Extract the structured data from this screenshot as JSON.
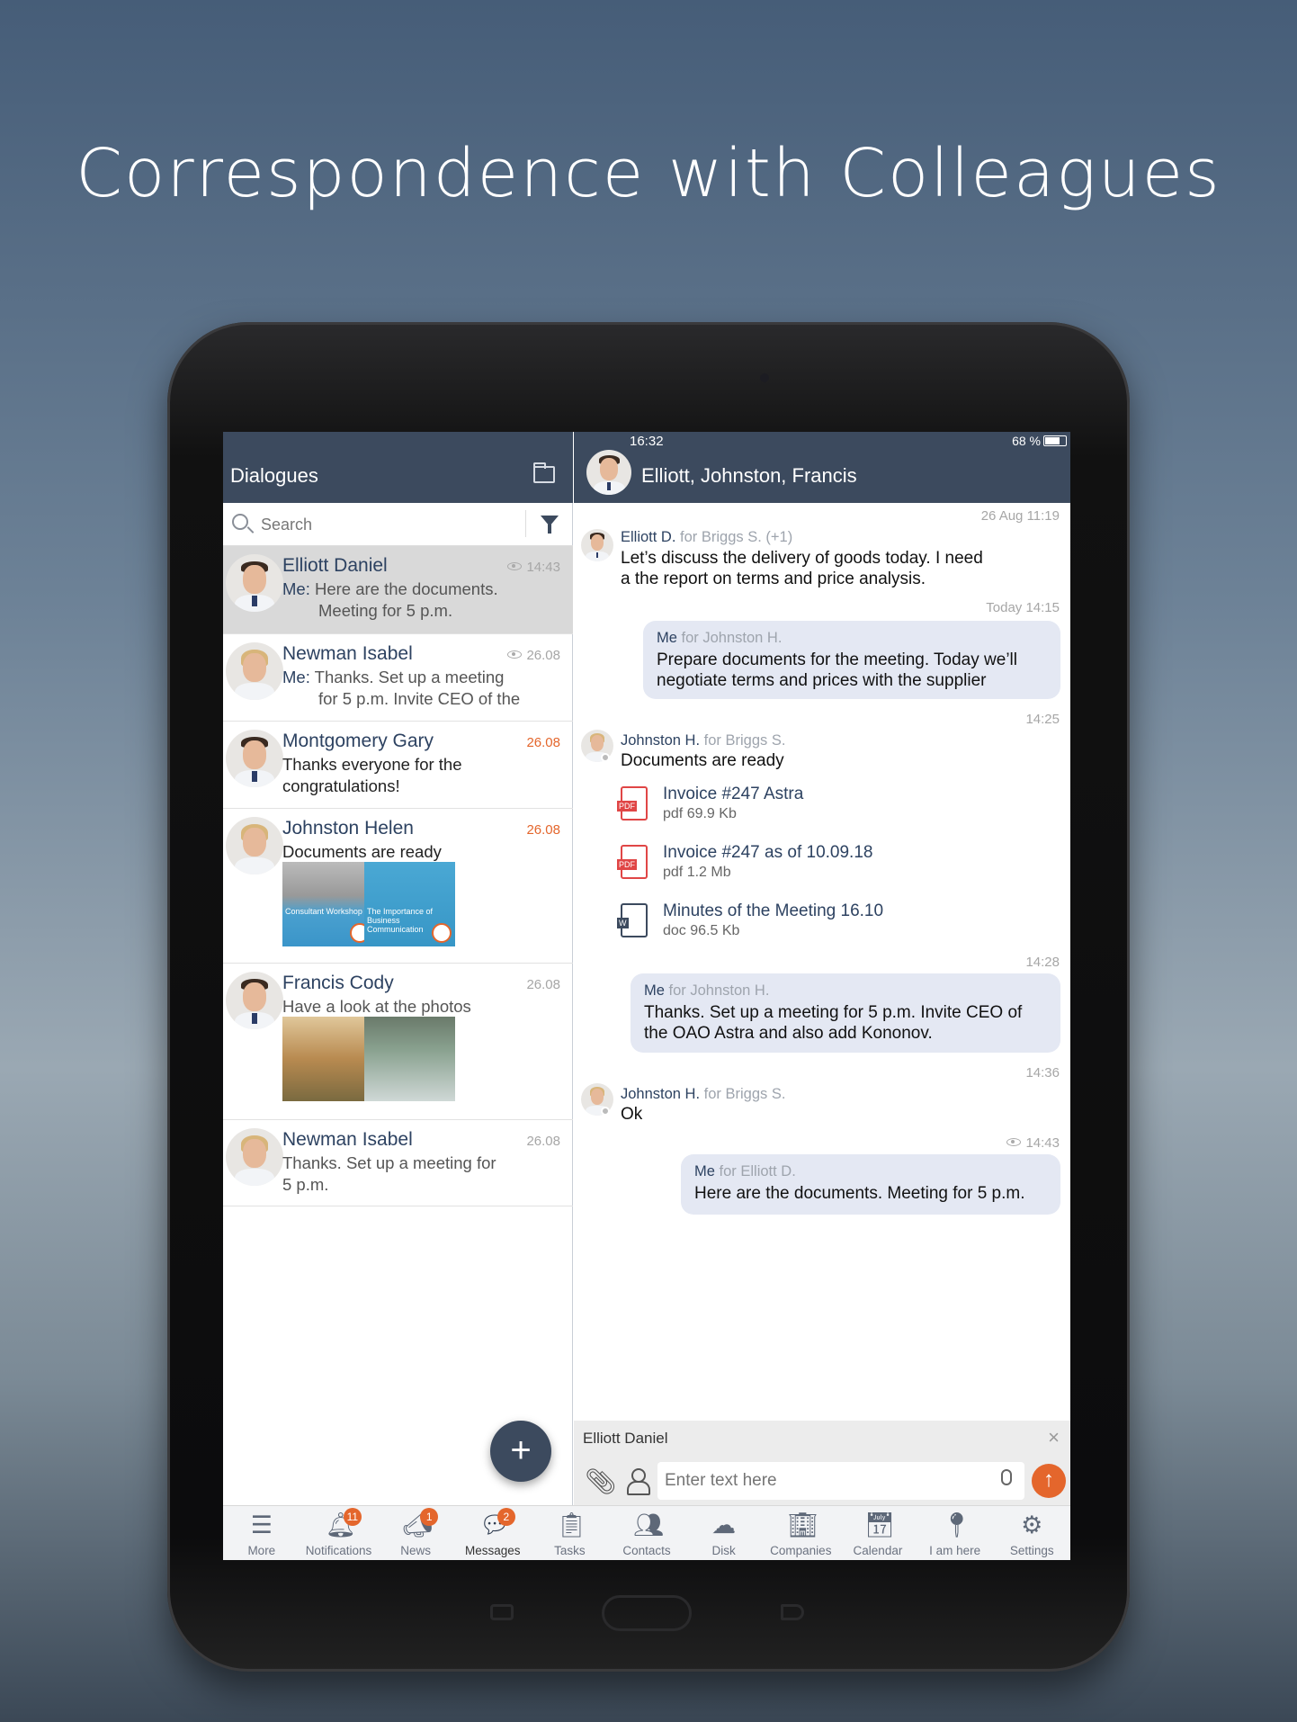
{
  "headline": "Correspondence with Colleagues",
  "colors": {
    "header": "#3c4a5e",
    "accent": "#e4662c",
    "bubble": "#e4e8f3"
  },
  "status": {
    "time": "16:32",
    "battery": "68 %",
    "battery_level": 0.68
  },
  "left": {
    "title": "Dialogues",
    "folder_icon": "folder-icon",
    "search_placeholder": "Search",
    "filter_icon": "filter-icon",
    "items": [
      {
        "name": "Elliott Daniel",
        "time": "14:43",
        "seen": true,
        "prefix": "Me:",
        "line1": "Here are the documents.",
        "line2": "Meeting for 5 p.m."
      },
      {
        "name": "Newman Isabel",
        "time": "26.08",
        "seen": true,
        "prefix": "Me:",
        "line1": "Thanks. Set up a meeting",
        "line2": "for 5 p.m. Invite CEO of the"
      },
      {
        "name": "Montgomery Gary",
        "time": "26.08",
        "line1": "Thanks everyone for the",
        "line2": "congratulations!"
      },
      {
        "name": "Johnston Helen",
        "time": "26.08",
        "line1": "Documents are ready",
        "thumbs": [
          "Consultant Workshop",
          "The Importance of Business Communication"
        ]
      },
      {
        "name": "Francis Cody",
        "time": "26.08",
        "line1": "Have a look at the photos"
      },
      {
        "name": "Newman Isabel",
        "time": "26.08",
        "line1": "Thanks. Set up a meeting for",
        "line2": "5 p.m."
      }
    ],
    "fab": "+"
  },
  "chat": {
    "title": "Elliott, Johnston, Francis",
    "messages": {
      "m1": {
        "ts": "26 Aug 11:19",
        "sender": "Elliott D.",
        "for": "for Briggs S. (+1)",
        "line1": "Let’s discuss the delivery of goods today. I need",
        "line2": "a the report on terms and price analysis."
      },
      "m2": {
        "ts": "Today 14:15",
        "sender": "Me",
        "for": "for Johnston H.",
        "line1": "Prepare documents for the meeting. Today we’ll",
        "line2": "negotiate terms and prices with the supplier"
      },
      "m3": {
        "ts": "14:25",
        "sender": "Johnston H.",
        "for": "for Briggs S.",
        "line1": "Documents are ready",
        "files": [
          {
            "name": "Invoice #247 Astra",
            "meta": "pdf  69.9 Kb",
            "type": "PDF"
          },
          {
            "name": "Invoice #247 as of 10.09.18",
            "meta": "pdf  1.2 Mb",
            "type": "PDF"
          },
          {
            "name": "Minutes of the Meeting 16.10",
            "meta": "doc  96.5 Kb",
            "type": "W"
          }
        ]
      },
      "m4": {
        "ts": "14:28",
        "sender": "Me",
        "for": "for Johnston H.",
        "line1": "Thanks. Set up a meeting for 5 p.m. Invite CEO of",
        "line2": "the OAO Astra and also add Kononov."
      },
      "m5": {
        "ts": "14:36",
        "sender": "Johnston H.",
        "for": "for Briggs S.",
        "line1": "Ok"
      },
      "m6": {
        "ts": "14:43",
        "seen": true,
        "sender": "Me",
        "for": "for Elliott D.",
        "line1": "Here are the documents. Meeting for 5 p.m."
      }
    },
    "reply_to": "Elliott Daniel",
    "close": "×",
    "input_placeholder": "Enter text here"
  },
  "nav": [
    {
      "label": "More",
      "icon": "menu-icon",
      "glyph": "☰"
    },
    {
      "label": "Notifications",
      "icon": "bell-icon",
      "glyph": "🔔︎",
      "badge": "11"
    },
    {
      "label": "News",
      "icon": "megaphone-icon",
      "glyph": "📣︎",
      "badge": "1"
    },
    {
      "label": "Messages",
      "icon": "chat-icon",
      "glyph": "💬︎",
      "badge": "2",
      "active": true
    },
    {
      "label": "Tasks",
      "icon": "clipboard-icon",
      "glyph": "📋︎"
    },
    {
      "label": "Contacts",
      "icon": "contacts-icon",
      "glyph": "👥︎"
    },
    {
      "label": "Disk",
      "icon": "cloud-icon",
      "glyph": "☁"
    },
    {
      "label": "Companies",
      "icon": "building-icon",
      "glyph": "🏢︎"
    },
    {
      "label": "Calendar",
      "icon": "calendar-icon",
      "glyph": "📅︎"
    },
    {
      "label": "I am here",
      "icon": "location-pin-icon",
      "glyph": "📍︎"
    },
    {
      "label": "Settings",
      "icon": "gear-icon",
      "glyph": "⚙"
    }
  ]
}
